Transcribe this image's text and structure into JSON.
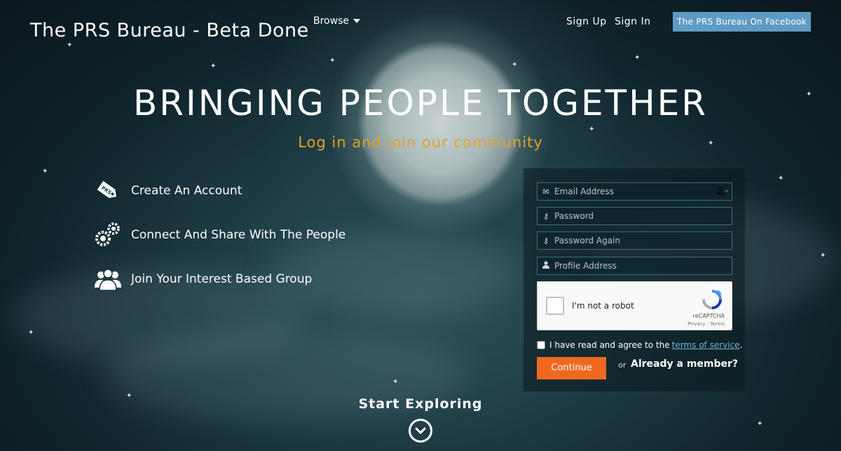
{
  "header": {
    "site_title": "The PRS Bureau - Beta Done",
    "browse_label": "Browse",
    "signup_label": "Sign Up",
    "signin_label": "Sign In",
    "facebook_label": "The PRS Bureau On Facebook"
  },
  "hero": {
    "title": "BRINGING PEOPLE TOGETHER",
    "subtitle": "Log in and join our community"
  },
  "features": [
    {
      "label": "Create An Account",
      "icon": "tag-icon"
    },
    {
      "label": "Connect And Share With The People",
      "icon": "gears-icon"
    },
    {
      "label": "Join Your Interest Based Group",
      "icon": "group-icon"
    }
  ],
  "signup_form": {
    "email_placeholder": "Email Address",
    "password_placeholder": "Password",
    "password_again_placeholder": "Password Again",
    "profile_placeholder": "Profile Address",
    "captcha_label": "I'm not a robot",
    "captcha_brand": "reCAPTCHA",
    "captcha_terms": "Privacy - Terms",
    "agree_text": "I have read and agree to the",
    "terms_link": "terms of service",
    "agree_period": ".",
    "continue_label": "Continue",
    "or_label": "or",
    "member_label": "Already a member?"
  },
  "footer": {
    "explore_label": "Start Exploring"
  },
  "colors": {
    "accent_orange": "#f06820",
    "subtitle_gold": "#e2a324",
    "facebook_blue": "#5e9bc4"
  }
}
